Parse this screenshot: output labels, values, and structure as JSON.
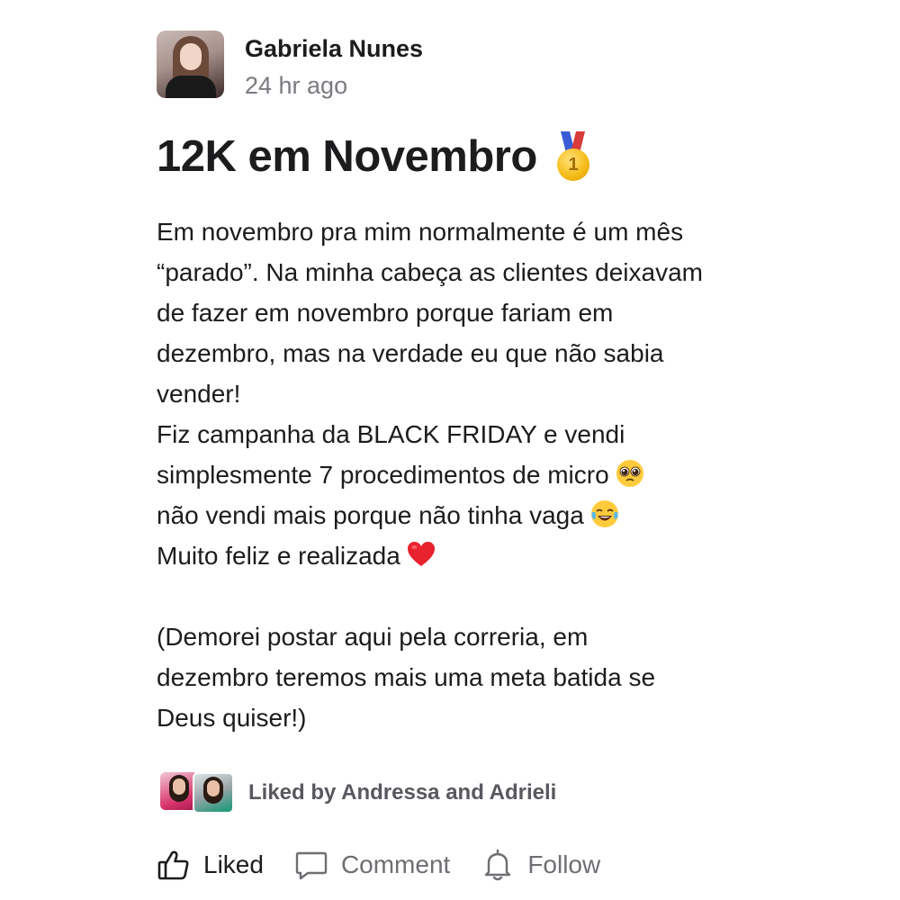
{
  "post": {
    "author": "Gabriela Nunes",
    "time": "24 hr ago",
    "title": "12K em Novembro",
    "title_emoji": "1st-place-medal-icon",
    "body": [
      "Em novembro pra mim normalmente é um mês",
      "“parado”. Na minha cabeça as clientes deixavam",
      "de fazer em novembro porque fariam em",
      "dezembro, mas na verdade eu que não sabia",
      "vender!",
      "Fiz campanha da BLACK FRIDAY e vendi",
      "simplesmente 7 procedimentos de micro",
      "não vendi mais porque não tinha vaga",
      "Muito feliz e realizada",
      "(Demorei postar aqui pela correria, em",
      "dezembro teremos mais uma meta batida se",
      "Deus quiser!)"
    ]
  },
  "likes": {
    "text": "Liked by Andressa and Adrieli"
  },
  "actions": {
    "like_label": "Liked",
    "comment_label": "Comment",
    "follow_label": "Follow"
  },
  "colors": {
    "text": "#1c1c1e",
    "muted": "#7a7a80",
    "action_muted": "#6e6e73"
  }
}
